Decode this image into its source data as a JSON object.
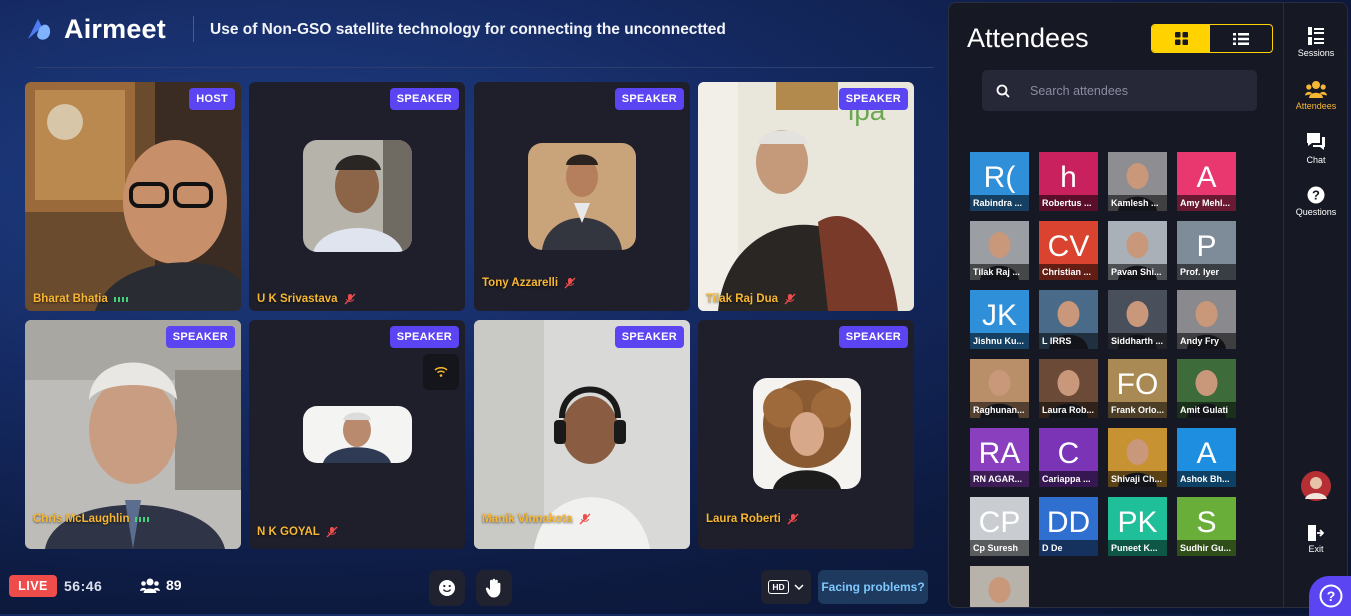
{
  "app": {
    "name": "Airmeet",
    "session_title": "Use of Non-GSO satellite technology for connecting the unconnectted"
  },
  "stage": {
    "tiles": [
      {
        "name": "Bharat Bhatia",
        "badge": "HOST",
        "status": "speaking"
      },
      {
        "name": "U K Srivastava",
        "badge": "SPEAKER",
        "status": "muted"
      },
      {
        "name": "Tony Azzarelli",
        "badge": "SPEAKER",
        "status": "muted"
      },
      {
        "name": "Tilak Raj Dua",
        "badge": "SPEAKER",
        "status": "muted"
      },
      {
        "name": "Chris McLaughlin",
        "badge": "SPEAKER",
        "status": "speaking"
      },
      {
        "name": "N K GOYAL",
        "badge": "SPEAKER",
        "status": "muted"
      },
      {
        "name": "Manik Vinnakota",
        "badge": "SPEAKER",
        "status": "muted"
      },
      {
        "name": "Laura Roberti",
        "badge": "SPEAKER",
        "status": "muted"
      }
    ]
  },
  "bottom": {
    "live_label": "LIVE",
    "timer": "56:46",
    "attendee_count": "89",
    "quality_label": "HD",
    "facing_problems": "Facing problems?"
  },
  "attendees": {
    "title": "Attendees",
    "search_placeholder": "Search attendees",
    "people": [
      {
        "label": "Rabindra ...",
        "initials": "R(",
        "color": "#2f8fd8"
      },
      {
        "label": "Robertus ...",
        "initials": "h",
        "color": "#c8215e"
      },
      {
        "label": "Kamlesh ...",
        "initials": "",
        "color": "#8e8d91"
      },
      {
        "label": "Amy Mehl...",
        "initials": "A",
        "color": "#e8386f"
      },
      {
        "label": "Tilak Raj ...",
        "initials": "",
        "color": "#9b9ea3"
      },
      {
        "label": "Christian ...",
        "initials": "CV",
        "color": "#d9432f"
      },
      {
        "label": "Pavan Shi...",
        "initials": "",
        "color": "#a9b0b8"
      },
      {
        "label": "Prof. Iyer",
        "initials": "P",
        "color": "#7e8b98"
      },
      {
        "label": "Jishnu Ku...",
        "initials": "JK",
        "color": "#2f8fd8"
      },
      {
        "label": "L IRRS",
        "initials": "",
        "color": "#4a6a8a"
      },
      {
        "label": "Siddharth ...",
        "initials": "",
        "color": "#4a4f5c"
      },
      {
        "label": "Andy Fry",
        "initials": "",
        "color": "#8a8a8e"
      },
      {
        "label": "Raghunan...",
        "initials": "",
        "color": "#b98f6a"
      },
      {
        "label": "Laura Rob...",
        "initials": "",
        "color": "#6b4a38"
      },
      {
        "label": "Frank Orlo...",
        "initials": "FO",
        "color": "#a98a55"
      },
      {
        "label": "Amit Gulati",
        "initials": "",
        "color": "#3d6b3a"
      },
      {
        "label": "RN AGAR...",
        "initials": "RA",
        "color": "#8a3fbf"
      },
      {
        "label": "Cariappa ...",
        "initials": "C",
        "color": "#7a34b5"
      },
      {
        "label": "Shivaji Ch...",
        "initials": "",
        "color": "#c79232"
      },
      {
        "label": "Ashok Bh...",
        "initials": "A",
        "color": "#1e8fe0"
      },
      {
        "label": "Cp Suresh",
        "initials": "CP",
        "color": "#c9ccd1"
      },
      {
        "label": "D De",
        "initials": "DD",
        "color": "#2f6fd0"
      },
      {
        "label": "Puneet K...",
        "initials": "PK",
        "color": "#1fbf9a"
      },
      {
        "label": "Sudhir Gu...",
        "initials": "S",
        "color": "#6aae3a"
      },
      {
        "label": "",
        "initials": "",
        "color": "#b7b2aa"
      }
    ]
  },
  "rail": {
    "sessions": "Sessions",
    "attendees": "Attendees",
    "chat": "Chat",
    "questions": "Questions",
    "exit": "Exit"
  },
  "colors": {
    "accent_yellow": "#f7b733",
    "badge_purple": "#5b44f2",
    "live_red": "#ef4c4c"
  }
}
